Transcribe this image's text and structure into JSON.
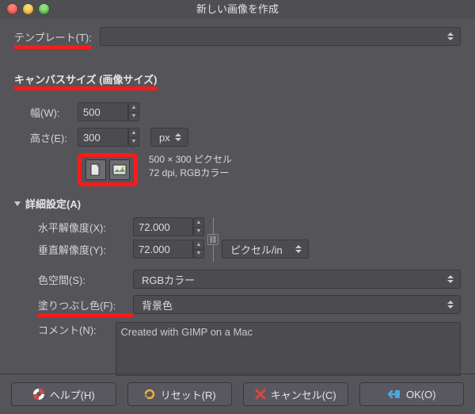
{
  "window": {
    "title": "新しい画像を作成"
  },
  "template": {
    "label": "テンプレート(T):",
    "value": ""
  },
  "canvas": {
    "section_title": "キャンバスサイズ (画像サイズ)",
    "width_label": "幅(W):",
    "width_value": "500",
    "height_label": "高さ(E):",
    "height_value": "300",
    "unit": "px",
    "info_line1": "500 × 300 ピクセル",
    "info_line2": "72 dpi, RGBカラー"
  },
  "advanced": {
    "section_title": "詳細設定(A)",
    "xres_label": "水平解像度(X):",
    "xres_value": "72.000",
    "yres_label": "垂直解像度(Y):",
    "yres_value": "72.000",
    "res_unit": "ピクセル/in",
    "colorspace_label": "色空間(S):",
    "colorspace_value": "RGBカラー",
    "fill_label": "塗りつぶし色(F):",
    "fill_value": "背景色",
    "comment_label": "コメント(N):",
    "comment_value": "Created with GIMP on a Mac"
  },
  "buttons": {
    "help": "ヘルプ(H)",
    "reset": "リセット(R)",
    "cancel": "キャンセル(C)",
    "ok": "OK(O)"
  }
}
